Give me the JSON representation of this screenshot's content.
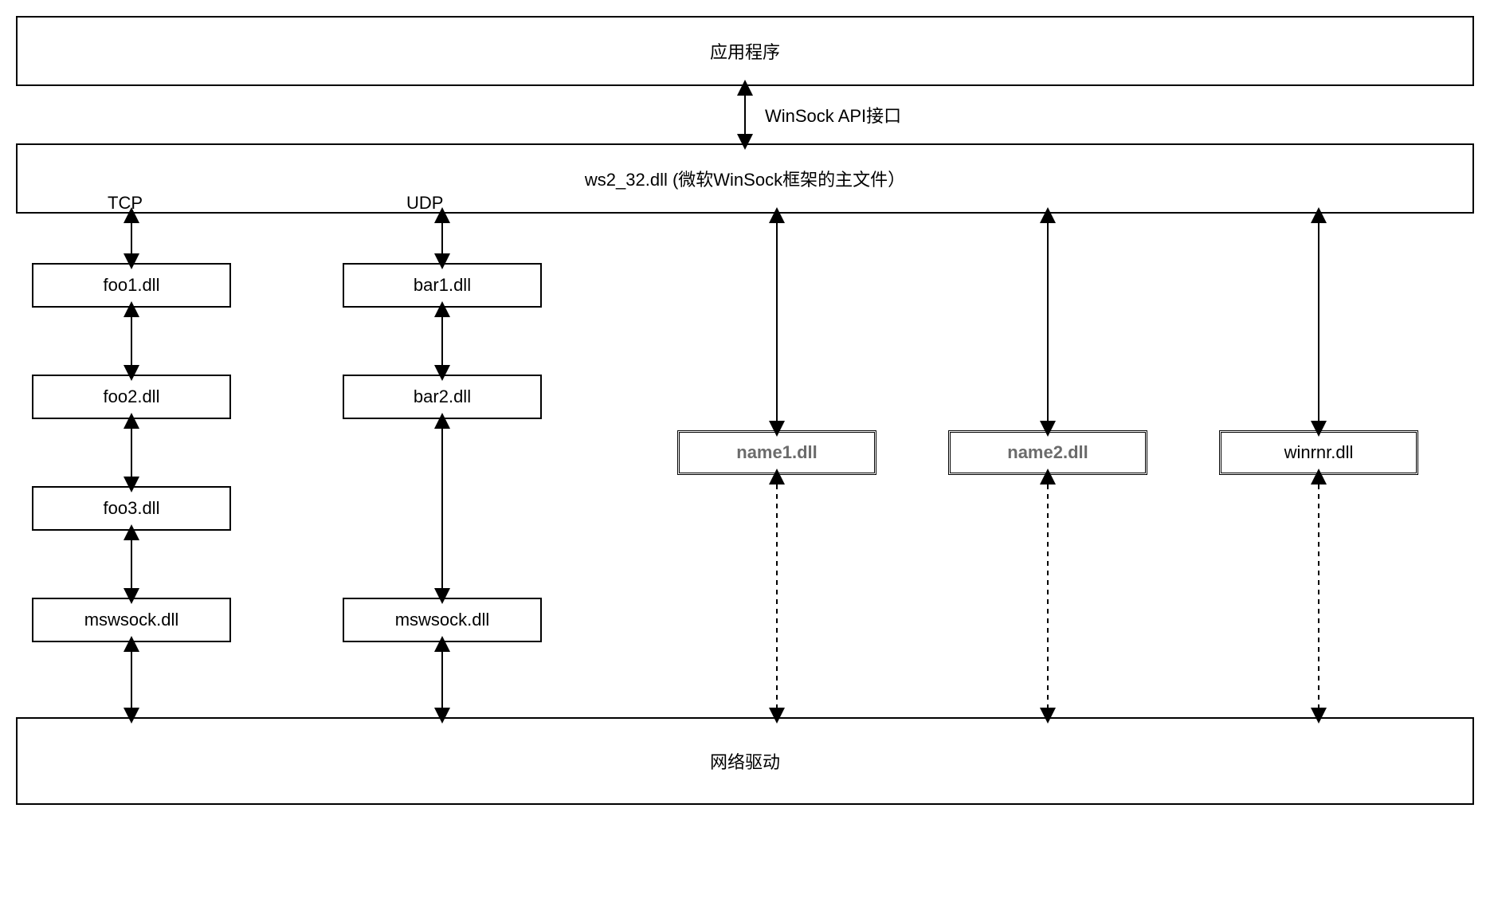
{
  "boxes": {
    "app": "应用程序",
    "ws2_32": "ws2_32.dll (微软WinSock框架的主文件）",
    "tcp_label": "TCP",
    "udp_label": "UDP",
    "foo1": "foo1.dll",
    "foo2": "foo2.dll",
    "foo3": "foo3.dll",
    "bar1": "bar1.dll",
    "bar2": "bar2.dll",
    "mswsock_tcp": "mswsock.dll",
    "mswsock_udp": "mswsock.dll",
    "name1": "name1.dll",
    "name2": "name2.dll",
    "winrnr": "winrnr.dll",
    "netdriver": "网络驱动"
  },
  "connector_label": "WinSock API接口"
}
